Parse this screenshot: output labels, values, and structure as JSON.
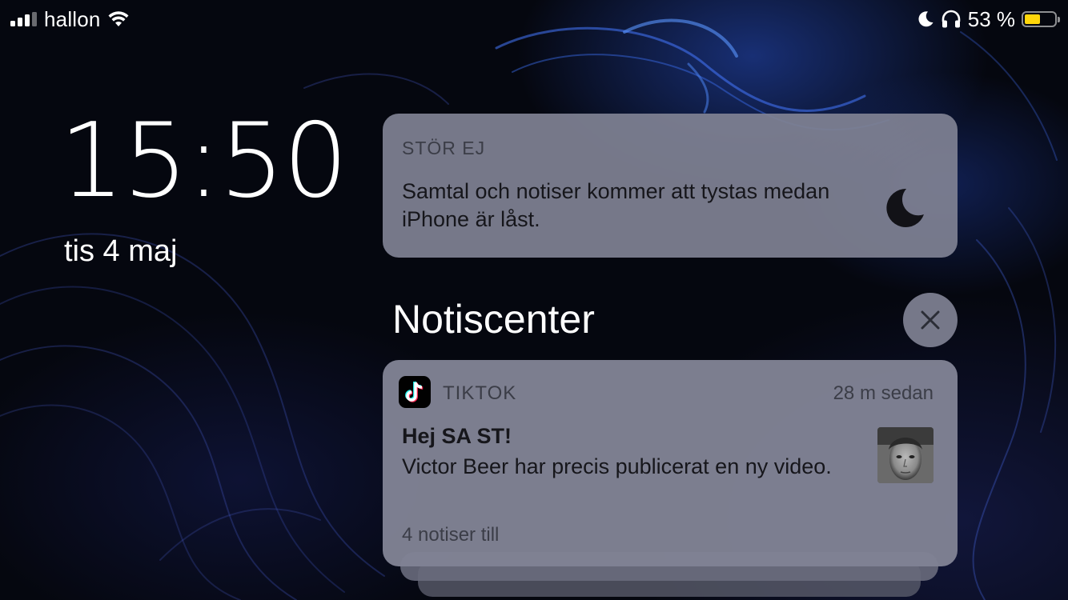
{
  "status_bar": {
    "carrier": "hallon",
    "battery_percent": "53 %",
    "battery_level": 0.53,
    "battery_color": "#ffd60a",
    "icons": [
      "signal-bars-icon",
      "wifi-icon",
      "moon-icon",
      "headphones-icon",
      "battery-icon"
    ]
  },
  "lock_screen": {
    "time": "15:50",
    "date": "tis 4 maj"
  },
  "do_not_disturb": {
    "header": "STÖR EJ",
    "message": "Samtal och notiser kommer att tystas medan iPhone är låst.",
    "icon": "moon-icon"
  },
  "notification_center": {
    "title": "Notiscenter",
    "close_icon": "close-icon"
  },
  "notification": {
    "app": "TIKTOK",
    "app_icon": "tiktok-logo-icon",
    "time": "28 m sedan",
    "title": "Hej SA ST!",
    "body": "Victor Beer har precis publicerat en ny video.",
    "more": "4 notiser till",
    "thumbnail": "video-thumbnail"
  }
}
